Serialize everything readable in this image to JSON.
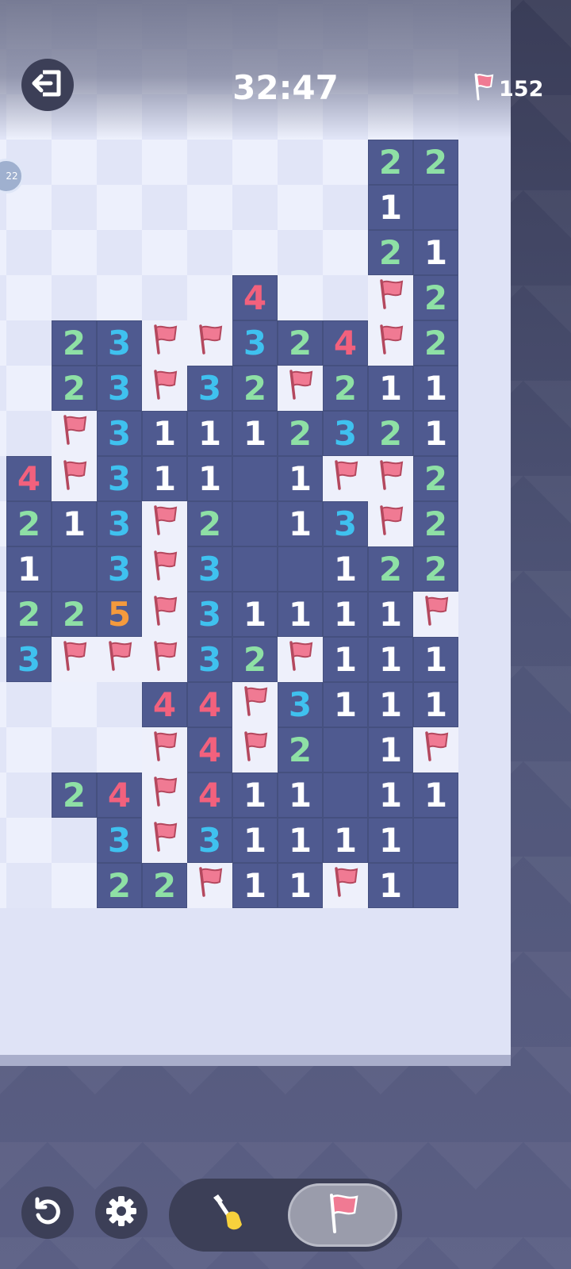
{
  "header": {
    "timer": "32:47",
    "flags_remaining": "152",
    "side_badge": "22"
  },
  "colors": {
    "revealed": "#4f5a90",
    "hidden_light": "#edf0fc",
    "hidden_dark": "#e1e5f7",
    "number_1": "#ffffff",
    "number_2": "#8ee0a5",
    "number_3": "#3fc1ef",
    "number_4": "#f2617d",
    "number_5": "#f59a3c",
    "flag": "#f07a93"
  },
  "icons": {
    "exit": "exit-icon",
    "flag": "flag-icon",
    "undo": "undo-icon",
    "settings": "gear-icon",
    "dig": "shovel-icon"
  },
  "controls": {
    "active_mode": "flag"
  },
  "grid": {
    "rows": 21,
    "cols": 11,
    "visible_rows": [
      "...........",
      "...........",
      "...........",
      "...........",
      "...........",
      "...........",
      ".........22",
      ".........1_",
      ".........21",
      "......4..F2",
      "..23FF324F2",
      "..23F32F211",
      "..F3111232 1",
      ".4F311_1FF2",
      ".213F2_13F2",
      ".1_3F3__122",
      ".225F31111F",
      ".3FFF32F111",
      "....44F3111",
      "....F4F2_1F",
      "..24F411_11",
      "...3F31111_",
      "...22F11F1_"
    ]
  }
}
